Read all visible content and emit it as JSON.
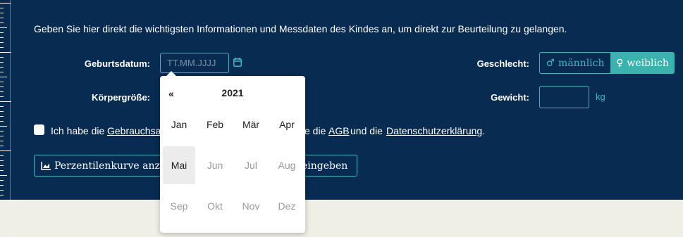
{
  "form": {
    "intro": "Geben Sie hier direkt die wichtigsten Informationen und Messdaten des Kindes an, um direkt zur Beurteilung zu gelangen.",
    "birthdate_label": "Geburtsdatum:",
    "birthdate_placeholder": "TT.MM.JJJJ",
    "height_label": "Körpergröße:",
    "gender_label": "Geschlecht:",
    "gender_male": "männlich",
    "gender_female": "weiblich",
    "gender_selected": "weiblich",
    "weight_label": "Gewicht:",
    "weight_unit": "kg",
    "consent_prefix": "Ich habe die",
    "consent_link_usage": "Gebrauchsa",
    "consent_middle": "e die",
    "consent_link_agb": "AGB",
    "consent_and": "und die",
    "consent_link_privacy": "Datenschutzerklärung",
    "consent_end": ".",
    "button_curve": "Perzentilenkurve anze",
    "button_enter": "eingeben"
  },
  "datepicker": {
    "prev": "«",
    "year": "2021",
    "months": [
      {
        "label": "Jan",
        "state": "enabled"
      },
      {
        "label": "Feb",
        "state": "enabled"
      },
      {
        "label": "Mär",
        "state": "enabled"
      },
      {
        "label": "Apr",
        "state": "enabled"
      },
      {
        "label": "Mai",
        "state": "selected"
      },
      {
        "label": "Jun",
        "state": "disabled"
      },
      {
        "label": "Jul",
        "state": "disabled"
      },
      {
        "label": "Aug",
        "state": "disabled"
      },
      {
        "label": "Sep",
        "state": "disabled"
      },
      {
        "label": "Okt",
        "state": "disabled"
      },
      {
        "label": "Nov",
        "state": "disabled"
      },
      {
        "label": "Dez",
        "state": "disabled"
      }
    ]
  },
  "colors": {
    "panel": "#082b52",
    "accent": "#3fb7bd",
    "footer": "#efefe6"
  }
}
